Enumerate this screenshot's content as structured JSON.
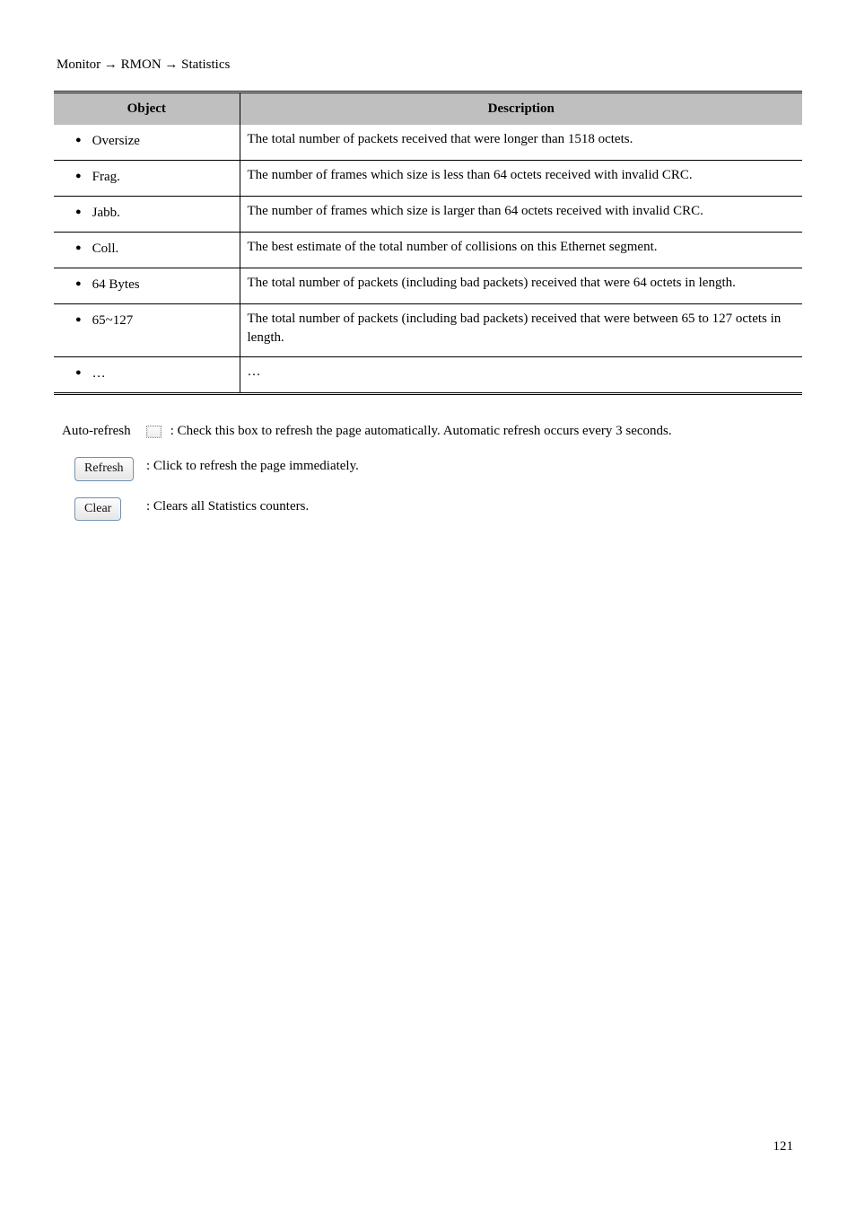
{
  "section_title": "Monitor → RMON → Statistics",
  "table": {
    "header_obj": "Object",
    "header_desc": "Description",
    "rows": [
      {
        "obj": "Oversize",
        "desc": "The total number of packets received that were longer than 1518 octets."
      },
      {
        "obj": "Frag.",
        "desc": "The number of frames which size is less than 64 octets received with invalid CRC."
      },
      {
        "obj": "Jabb.",
        "desc": "The number of frames which size is larger than 64 octets received with invalid CRC."
      },
      {
        "obj": "Coll.",
        "desc": "The best estimate of the total number of collisions on this Ethernet segment."
      },
      {
        "obj": "64 Bytes",
        "desc": "The total number of packets (including bad packets) received that were 64 octets in length."
      },
      {
        "obj": "65~127",
        "desc": "The total number of packets (including bad packets) received that were between 65 to 127 octets in length."
      },
      {
        "obj": "…",
        "desc": "…"
      }
    ]
  },
  "labels": {
    "auto_refresh": {
      "name": "Auto-refresh",
      "glyph_desc": "checkbox",
      "desc": ": Check this box to refresh the page automatically. Automatic refresh occurs every 3 seconds."
    },
    "refresh": {
      "name": "Refresh",
      "desc": ": Click to refresh the page immediately."
    },
    "clear": {
      "name": "Clear",
      "desc": ": Clears all Statistics counters."
    }
  },
  "page_number": "121"
}
